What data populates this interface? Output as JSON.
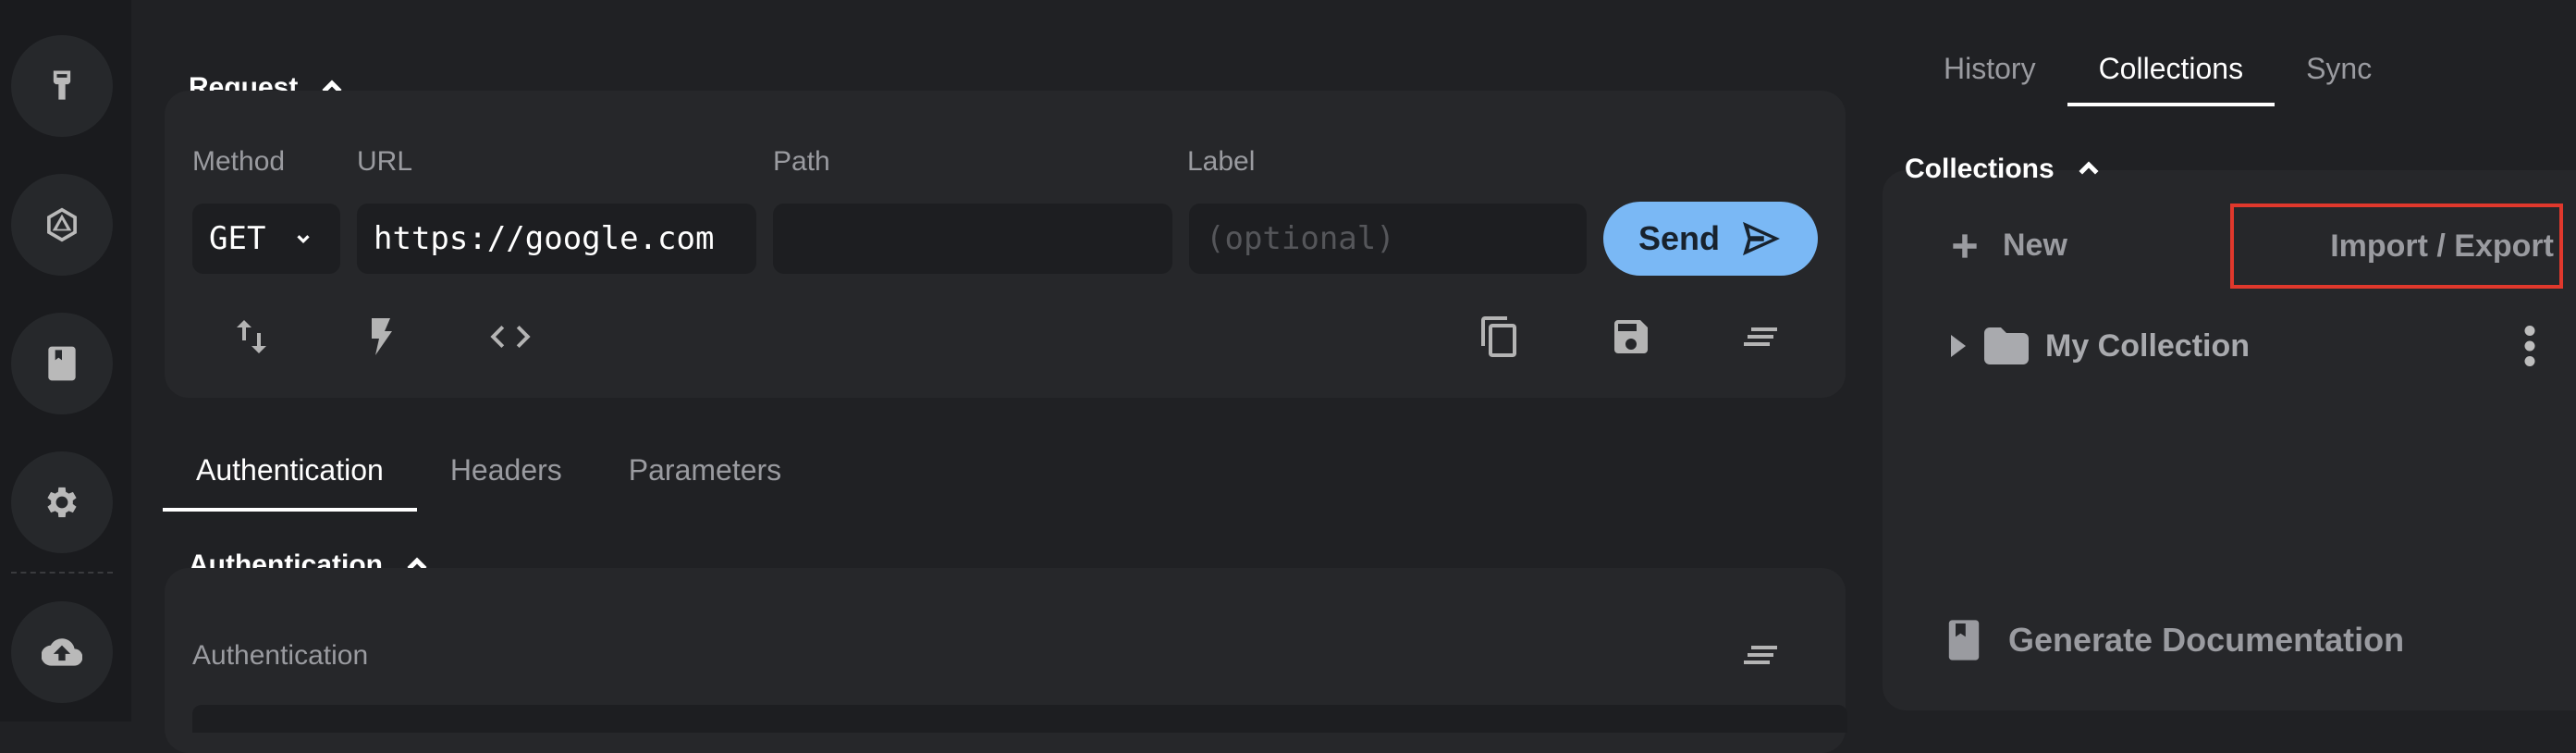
{
  "sidebar": {
    "icons": [
      "plug-icon",
      "graphql-icon",
      "book-icon",
      "gear-icon",
      "cloud-upload-icon"
    ]
  },
  "request": {
    "section_title": "Request",
    "method_label": "Method",
    "url_label": "URL",
    "path_label": "Path",
    "label_label": "Label",
    "method_value": "GET",
    "url_value": "https://google.com",
    "path_value": "",
    "label_placeholder": "(optional)",
    "send_label": "Send"
  },
  "request_tabs": [
    "Authentication",
    "Headers",
    "Parameters"
  ],
  "auth": {
    "section_title": "Authentication",
    "field_label": "Authentication"
  },
  "right_tabs": [
    "History",
    "Collections",
    "Sync"
  ],
  "collections": {
    "section_title": "Collections",
    "new_label": "New",
    "import_export_label": "Import / Export",
    "items": [
      "My Collection"
    ],
    "generate_docs_label": "Generate Documentation"
  },
  "colors": {
    "accent": "#7ab8f5",
    "highlight_border": "#e0382c",
    "background": "#202124",
    "card": "#26272a"
  }
}
